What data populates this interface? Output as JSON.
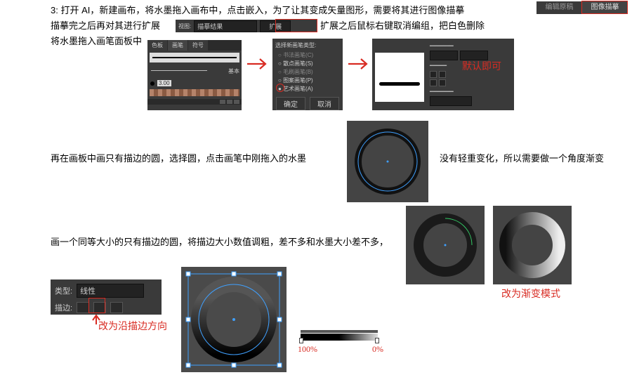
{
  "toolbar_right": {
    "btn1": "编辑原稿",
    "btn2": "图像描摹"
  },
  "step3_line1": "3: 打开 AI，新建画布，将水墨拖入画布中，点击嵌入，为了让其变成矢量图形，需要将其进行图像描摹",
  "step3_line2a": "描摹完之后再对其进行扩展",
  "step3_line2b": "扩展之后鼠标右键取消编组，把白色删除",
  "step3_line3": "将水墨拖入画笔面板中",
  "trace_panel": {
    "label": "视图:",
    "value": "描摹结果",
    "btn": "扩展"
  },
  "brush_panel": {
    "tabs": [
      "色板",
      "画笔",
      "符号"
    ],
    "row_label": "基本",
    "thick": "3.00"
  },
  "dialog": {
    "title": "选择新画笔类型:",
    "opts": [
      "书法画笔(C)",
      "散点画笔(S)",
      "毛刷画笔(B)",
      "图案画笔(P)",
      "艺术画笔(A)"
    ],
    "ok": "确定",
    "cancel": "取消"
  },
  "prop_panel": {
    "note": "默认即可"
  },
  "row2_left": "再在画板中画只有描边的圆，选择圆，点击画笔中刚拖入的水墨",
  "row2_right": "没有轻重变化，所以需要做一个角度渐变",
  "row3_left": "画一个同等大小的只有描边的圆，将描边大小数值调粗，差不多和水墨大小差不多，",
  "row3_note": "改为渐变模式",
  "grad_panel": {
    "type_label": "类型:",
    "type_val": "线性",
    "stroke_label": "描边:"
  },
  "grad_note": "改为沿描边方向",
  "opacity": {
    "p100": "100%",
    "p0": "0%"
  }
}
